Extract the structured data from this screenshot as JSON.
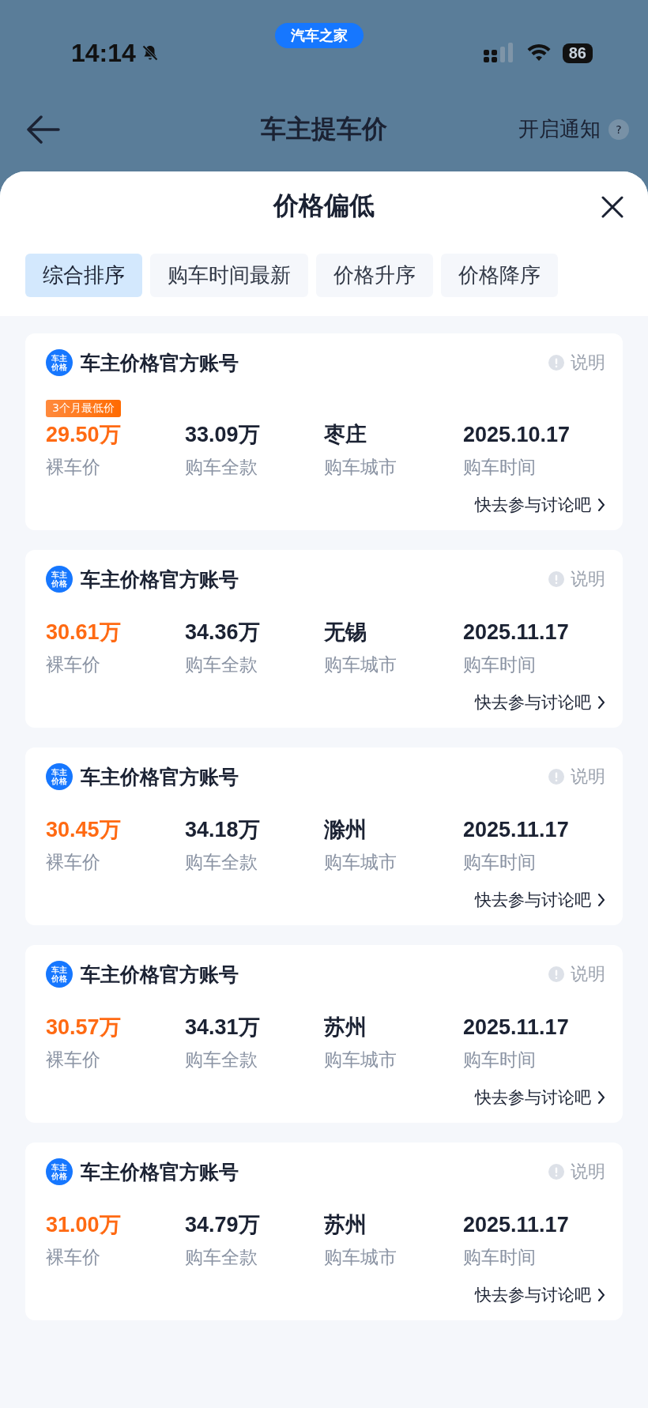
{
  "status_bar": {
    "time": "14:14",
    "app_badge": "汽车之家",
    "battery": "86"
  },
  "header": {
    "title": "车主提车价",
    "notify": "开启通知",
    "help": "?"
  },
  "sheet": {
    "title": "价格偏低",
    "tabs": [
      {
        "label": "综合排序",
        "selected": true
      },
      {
        "label": "购车时间最新",
        "selected": false
      },
      {
        "label": "价格升序",
        "selected": false
      },
      {
        "label": "价格降序",
        "selected": false
      }
    ],
    "cards": [
      {
        "logo_text": "车主价格",
        "account": "车主价格官方账号",
        "note": "说明",
        "badge": "3个月最低价",
        "price": "29.50万",
        "price_label": "裸车价",
        "total": "33.09万",
        "total_label": "购车全款",
        "city": "枣庄",
        "city_label": "购车城市",
        "date": "2025.10.17",
        "date_label": "购车时间",
        "link": "快去参与讨论吧"
      },
      {
        "logo_text": "车主价格",
        "account": "车主价格官方账号",
        "note": "说明",
        "price": "30.61万",
        "price_label": "裸车价",
        "total": "34.36万",
        "total_label": "购车全款",
        "city": "无锡",
        "city_label": "购车城市",
        "date": "2025.11.17",
        "date_label": "购车时间",
        "link": "快去参与讨论吧"
      },
      {
        "logo_text": "车主价格",
        "account": "车主价格官方账号",
        "note": "说明",
        "price": "30.45万",
        "price_label": "裸车价",
        "total": "34.18万",
        "total_label": "购车全款",
        "city": "滁州",
        "city_label": "购车城市",
        "date": "2025.11.17",
        "date_label": "购车时间",
        "link": "快去参与讨论吧"
      },
      {
        "logo_text": "车主价格",
        "account": "车主价格官方账号",
        "note": "说明",
        "price": "30.57万",
        "price_label": "裸车价",
        "total": "34.31万",
        "total_label": "购车全款",
        "city": "苏州",
        "city_label": "购车城市",
        "date": "2025.11.17",
        "date_label": "购车时间",
        "link": "快去参与讨论吧"
      },
      {
        "logo_text": "车主价格",
        "account": "车主价格官方账号",
        "note": "说明",
        "price": "31.00万",
        "price_label": "裸车价",
        "total": "34.79万",
        "total_label": "购车全款",
        "city": "苏州",
        "city_label": "购车城市",
        "date": "2025.11.17",
        "date_label": "购车时间",
        "link": "快去参与讨论吧"
      }
    ]
  }
}
